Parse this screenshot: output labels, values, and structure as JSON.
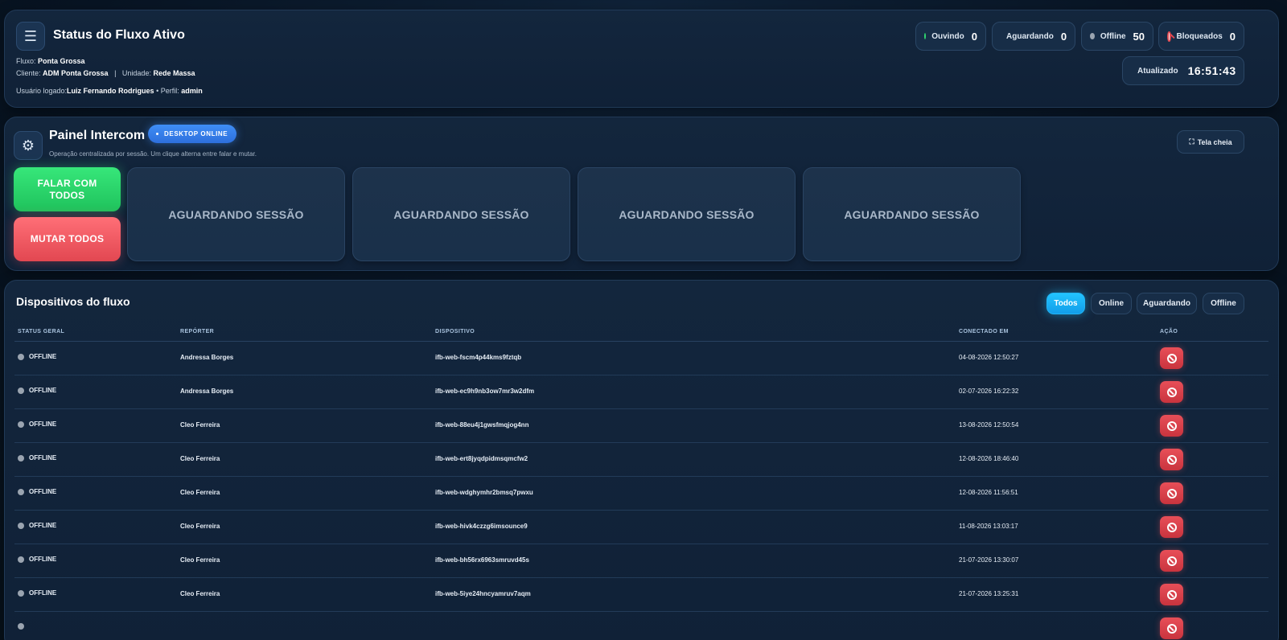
{
  "status_panel": {
    "title": "Status do Fluxo Ativo",
    "fluxo_label": "Fluxo:",
    "fluxo_value": "Ponta Grossa",
    "cliente_label": "Cliente:",
    "cliente_value": "ADM Ponta Grossa",
    "separator": "|",
    "unidade_label": "Unidade:",
    "unidade_value": "Rede Massa",
    "usuario_label": "Usuário logado:",
    "usuario_value": "Luiz Fernando Rodrigues",
    "perfil_label": "• Perfil:",
    "perfil_value": "admin",
    "stats": {
      "ouvindo": {
        "label": "Ouvindo",
        "value": "0",
        "color": "#2fd36f"
      },
      "aguardando": {
        "label": "Aguardando",
        "value": "0",
        "color": "#f2b12f"
      },
      "offline": {
        "label": "Offline",
        "value": "50",
        "color": "#9aa4b0"
      },
      "bloqueados": {
        "label": "Bloqueados",
        "value": "0",
        "color": "#e14b52"
      }
    },
    "updated_label": "Atualizado",
    "updated_time": "16:51:43"
  },
  "intercom": {
    "title": "Painel Intercom",
    "badge": "DESKTOP ONLINE",
    "subtitle": "Operação centralizada por sessão. Um clique alterna entre falar e mutar.",
    "fullscreen_label": "Tela cheia",
    "talk_all_label": "FALAR COM TODOS",
    "mute_all_label": "MUTAR TODOS",
    "sessions": [
      "AGUARDANDO SESSÃO",
      "AGUARDANDO SESSÃO",
      "AGUARDANDO SESSÃO",
      "AGUARDANDO SESSÃO"
    ]
  },
  "devices": {
    "title": "Dispositivos do fluxo",
    "filters": [
      "Todos",
      "Online",
      "Aguardando",
      "Offline"
    ],
    "active_filter": "Todos",
    "columns": [
      "STATUS GERAL",
      "REPÓRTER",
      "DISPOSITIVO",
      "CONECTADO EM",
      "AÇÃO"
    ],
    "rows": [
      {
        "status": "OFFLINE",
        "reporter": "Andressa Borges",
        "device": "ifb-web-fscm4p44kms9fztqb",
        "connected": "04-08-2026 12:50:27"
      },
      {
        "status": "OFFLINE",
        "reporter": "Andressa Borges",
        "device": "ifb-web-ec9h9nb3ow7mr3w2dfm",
        "connected": "02-07-2026 16:22:32"
      },
      {
        "status": "OFFLINE",
        "reporter": "Cleo Ferreira",
        "device": "ifb-web-88eu4j1gwsfmqjog4nn",
        "connected": "13-08-2026 12:50:54"
      },
      {
        "status": "OFFLINE",
        "reporter": "Cleo Ferreira",
        "device": "ifb-web-ert8jyqdpidmsqmcfw2",
        "connected": "12-08-2026 18:46:40"
      },
      {
        "status": "OFFLINE",
        "reporter": "Cleo Ferreira",
        "device": "ifb-web-wdghymhr2bmsq7pwxu",
        "connected": "12-08-2026 11:56:51"
      },
      {
        "status": "OFFLINE",
        "reporter": "Cleo Ferreira",
        "device": "ifb-web-hivk4czzg6imsounce9",
        "connected": "11-08-2026 13:03:17"
      },
      {
        "status": "OFFLINE",
        "reporter": "Cleo Ferreira",
        "device": "ifb-web-bh56rx6963smruvd45s",
        "connected": "21-07-2026 13:30:07"
      },
      {
        "status": "OFFLINE",
        "reporter": "Cleo Ferreira",
        "device": "ifb-web-5iye24hncyamruv7aqm",
        "connected": "21-07-2026 13:25:31"
      },
      {
        "status": "",
        "reporter": "",
        "device": "",
        "connected": ""
      }
    ]
  }
}
